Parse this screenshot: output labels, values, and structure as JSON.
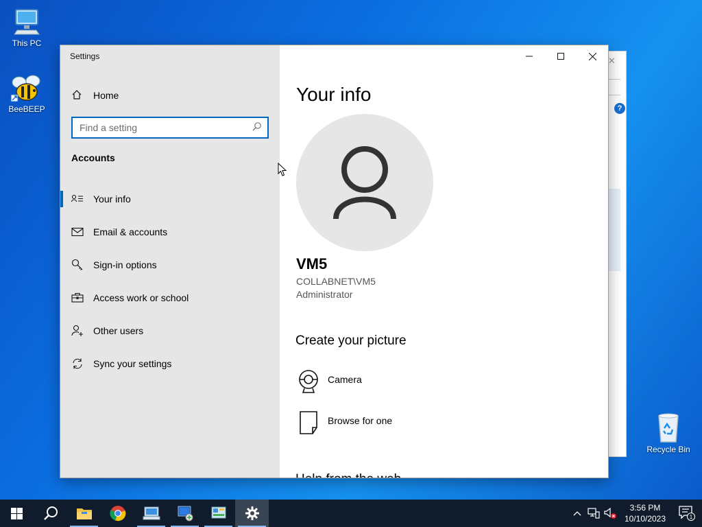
{
  "desktop": {
    "icons": [
      {
        "label": "This PC",
        "icon": "computer-icon"
      },
      {
        "label": "BeeBEEP",
        "icon": "bee-icon"
      },
      {
        "label": "Recycle Bin",
        "icon": "recycle-bin-icon"
      }
    ]
  },
  "window": {
    "title": "Settings",
    "caption": {
      "minimize": "minimize-icon",
      "maximize": "maximize-icon",
      "close": "close-icon"
    }
  },
  "sidebar": {
    "home_label": "Home",
    "search_placeholder": "Find a setting",
    "section_heading": "Accounts",
    "items": [
      {
        "label": "Your info",
        "icon": "contact-card-icon",
        "selected": true
      },
      {
        "label": "Email & accounts",
        "icon": "mail-icon",
        "selected": false
      },
      {
        "label": "Sign-in options",
        "icon": "key-icon",
        "selected": false
      },
      {
        "label": "Access work or school",
        "icon": "briefcase-icon",
        "selected": false
      },
      {
        "label": "Other users",
        "icon": "add-person-icon",
        "selected": false
      },
      {
        "label": "Sync your settings",
        "icon": "sync-icon",
        "selected": false
      }
    ]
  },
  "content": {
    "title": "Your info",
    "user": {
      "name": "VM5",
      "domain": "COLLABNET\\VM5",
      "role": "Administrator"
    },
    "create_picture": {
      "heading": "Create your picture",
      "options": [
        {
          "label": "Camera",
          "icon": "webcam-icon"
        },
        {
          "label": "Browse for one",
          "icon": "file-icon"
        }
      ]
    },
    "next_heading_partial": "Help from the web"
  },
  "taskbar": {
    "apps": [
      "start-icon",
      "search-icon",
      "file-explorer-icon",
      "chrome-icon",
      "remote-desktop-icon",
      "network-app-icon",
      "control-panel-icon",
      "settings-icon"
    ],
    "clock": {
      "time": "3:56 PM",
      "date": "10/10/2023"
    },
    "notification_count": "1"
  },
  "colors": {
    "accent": "#0067c0",
    "sidebar_bg": "#e6e6e6",
    "avatar_bg": "#e6e6e6",
    "taskbar_bg": "#101b2b"
  }
}
